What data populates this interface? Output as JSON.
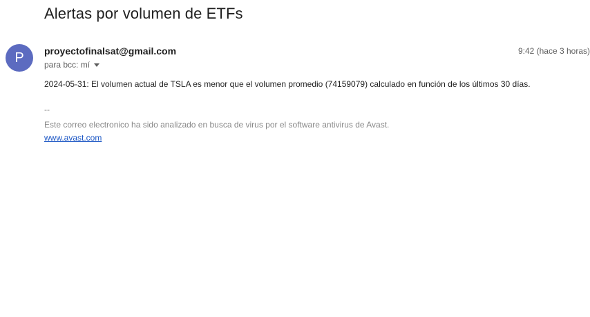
{
  "email": {
    "subject": "Alertas por volumen de ETFs",
    "avatar_letter": "P",
    "avatar_color": "#5c6bc0",
    "sender": "proyectofinalsat@gmail.com",
    "time": "9:42 (hace 3 horas)",
    "recipients": "para bcc: mí",
    "body": "2024-05-31: El volumen actual de TSLA es menor que el volumen promedio (74159079) calculado en función de los últimos 30 días.",
    "signature": {
      "separator": "--",
      "text": "Este correo electronico ha sido analizado en busca de virus por el software antivirus de Avast.",
      "link": "www.avast.com"
    }
  }
}
